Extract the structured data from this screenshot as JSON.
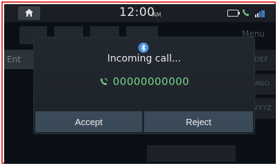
{
  "status_bar": {
    "time": "12:00",
    "ampm": "AM",
    "icons": [
      "home-icon",
      "battery-icon",
      "phone-status-icon",
      "signal-icon"
    ]
  },
  "background": {
    "entry_label": "Ent",
    "menu_label": "Menu",
    "keys": [
      "DEF",
      "MNO",
      "WXYZ"
    ]
  },
  "dialog": {
    "icon": "bluetooth-icon",
    "title": "Incoming call...",
    "number": "00000000000",
    "accept_label": "Accept",
    "reject_label": "Reject"
  },
  "colors": {
    "frame": "#e53935",
    "screen_bg": "#0b1016",
    "dialog_bg": "#22282f",
    "button_bg": "#3b4a59",
    "number_green": "#7bd389",
    "bluetooth_blue": "#4a90e2"
  }
}
